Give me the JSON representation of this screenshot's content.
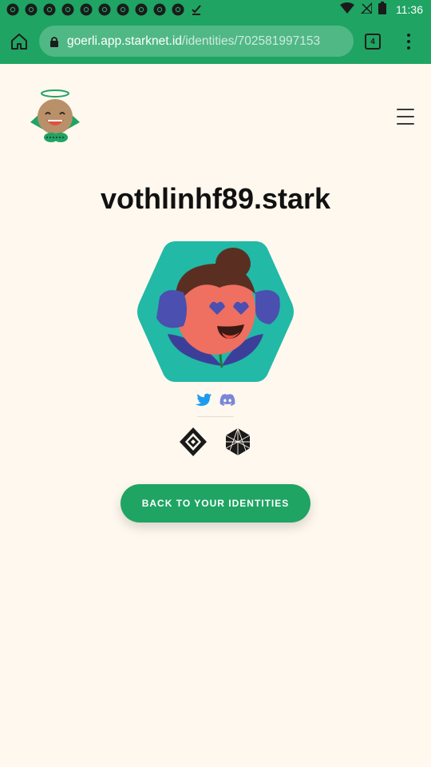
{
  "status_bar": {
    "time": "11:36",
    "notification_icons": [
      "chrome-icon",
      "chrome-icon",
      "chrome-icon",
      "chrome-icon",
      "chrome-icon",
      "chrome-icon",
      "chrome-icon",
      "chrome-icon",
      "chrome-icon",
      "chrome-icon",
      "download-done-icon"
    ],
    "right_icons": [
      "wifi-icon",
      "no-signal-icon",
      "battery-icon"
    ]
  },
  "browser": {
    "url_host": "goerli.app.starknet.id",
    "url_path": "/identities/702581997153",
    "tab_count": "4"
  },
  "page": {
    "domain_name": "vothlinhf89.stark",
    "social_icons": [
      "twitter-icon",
      "discord-icon"
    ],
    "badge_icons": [
      "diamond-badge-icon",
      "polyhedron-badge-icon"
    ],
    "back_button_label": "BACK TO YOUR IDENTITIES"
  },
  "colors": {
    "brand_green": "#1fa463",
    "background": "#fef8ee",
    "avatar_teal": "#22b9a6",
    "twitter_blue": "#1d9bf0",
    "discord_purple": "#7b86d8"
  }
}
